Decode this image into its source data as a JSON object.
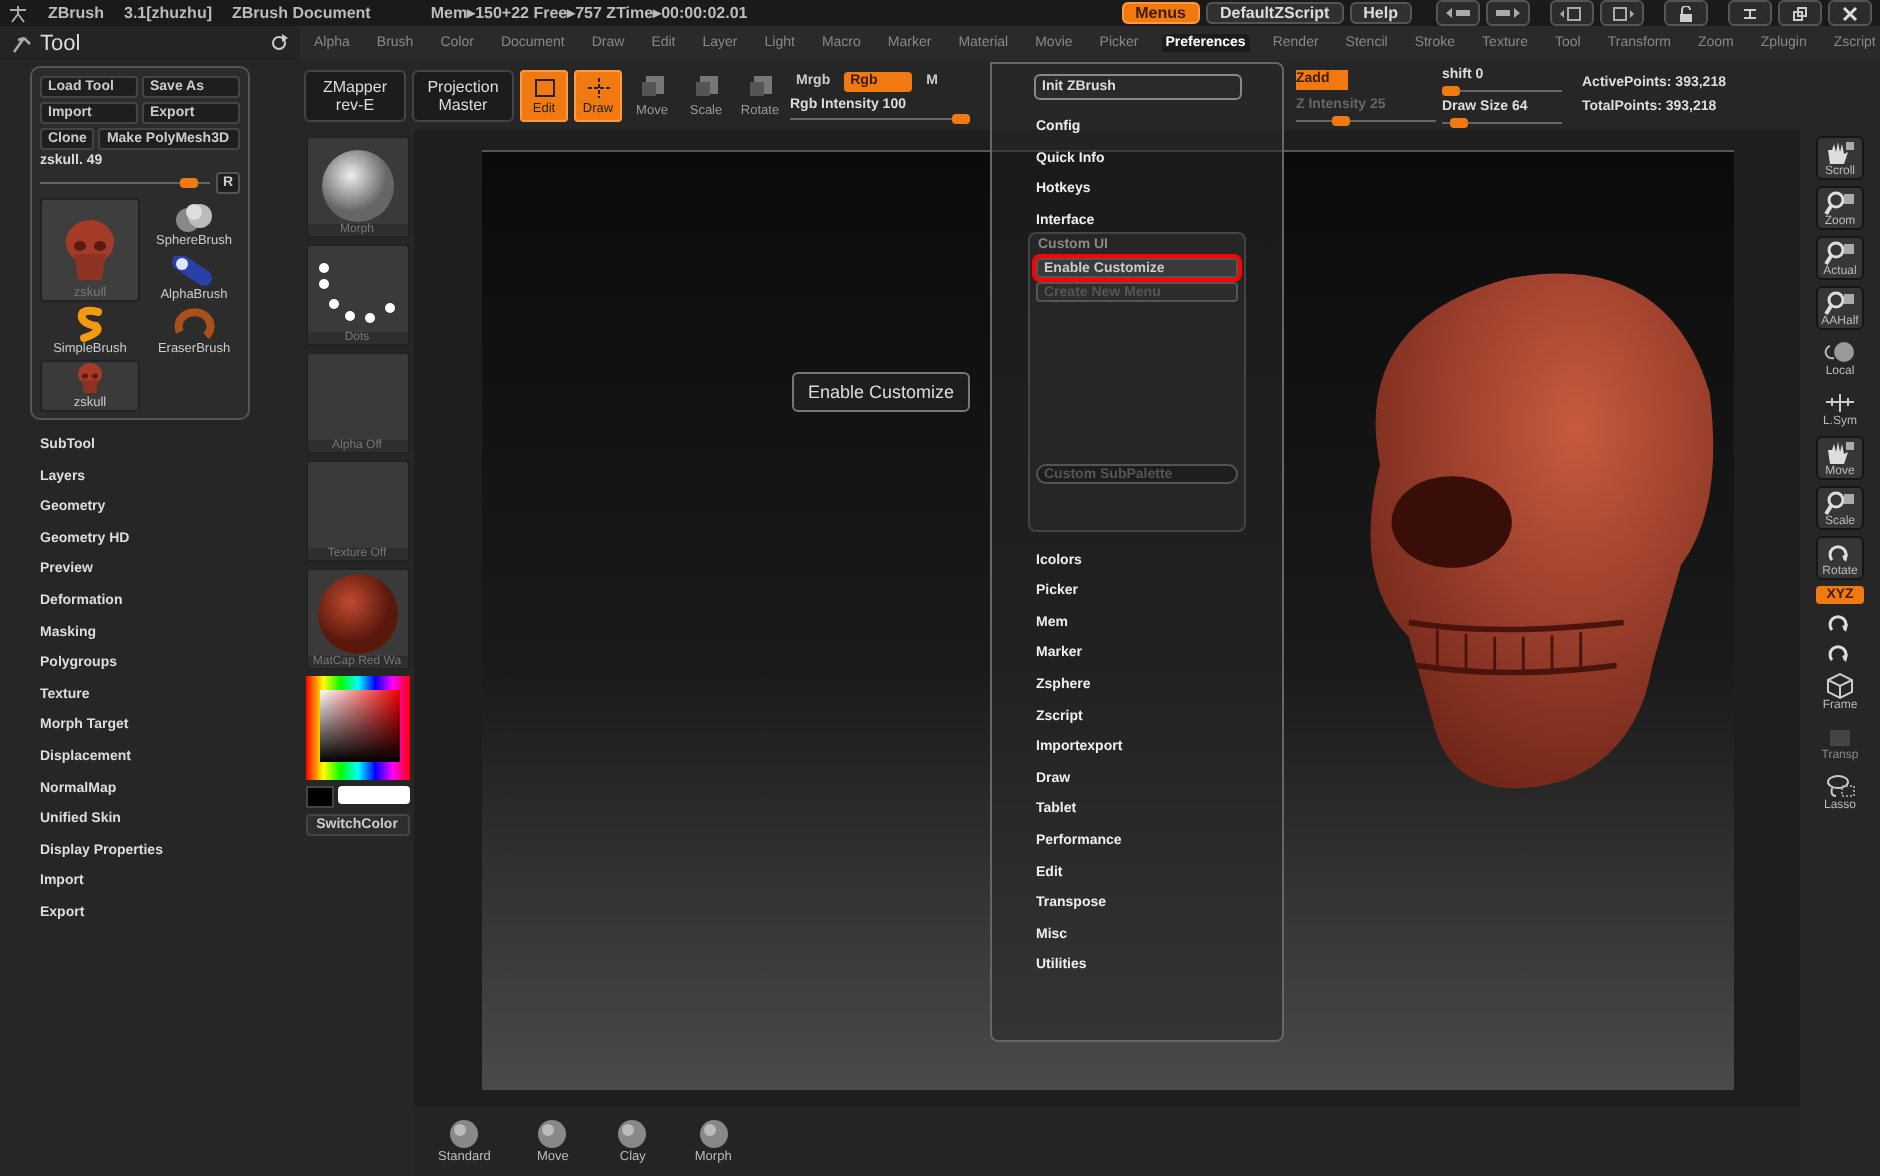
{
  "title_bar": {
    "app": "ZBrush",
    "version": "3.1[zhuzhu]",
    "document": "ZBrush Document",
    "stats": "Mem▸150+22 Free▸757 ZTime▸00:00:02.01",
    "buttons": [
      {
        "label": "Menus",
        "selected": true
      },
      {
        "label": "DefaultZScript",
        "selected": false
      },
      {
        "label": "Help",
        "selected": false
      }
    ]
  },
  "tool_palette": {
    "title": "Tool",
    "buttons": [
      "Load Tool",
      "Save As",
      "Import",
      "Export"
    ],
    "row_buttons": [
      "Clone",
      "Make PolyMesh3D"
    ],
    "slider": {
      "label": "zskull. 49",
      "level": 0.93
    },
    "reset": "R",
    "tools": [
      {
        "label": "zskull",
        "kind": "skull",
        "selected": true
      },
      {
        "label": "SimpleBrush",
        "kind": "simple",
        "selected": false
      },
      {
        "label": "zskull",
        "kind": "skull",
        "selected": false
      },
      {
        "label": "SphereBrush",
        "kind": "sphere",
        "selected": false
      },
      {
        "label": "AlphaBrush",
        "kind": "alpha",
        "selected": false
      },
      {
        "label": "EraserBrush",
        "kind": "eraser",
        "selected": false
      }
    ],
    "sections": [
      "SubTool",
      "Layers",
      "Geometry",
      "Geometry HD",
      "Preview",
      "Deformation",
      "Masking",
      "Polygroups",
      "Texture",
      "Morph Target",
      "Displacement",
      "NormalMap",
      "Unified Skin",
      "Display Properties",
      "Import",
      "Export"
    ]
  },
  "menu_bar": [
    {
      "label": "Alpha",
      "selected": false
    },
    {
      "label": "Brush",
      "selected": false
    },
    {
      "label": "Color",
      "selected": false
    },
    {
      "label": "Document",
      "selected": false
    },
    {
      "label": "Draw",
      "selected": false
    },
    {
      "label": "Edit",
      "selected": false
    },
    {
      "label": "Layer",
      "selected": false
    },
    {
      "label": "Light",
      "selected": false
    },
    {
      "label": "Macro",
      "selected": false
    },
    {
      "label": "Marker",
      "selected": false
    },
    {
      "label": "Material",
      "selected": false
    },
    {
      "label": "Movie",
      "selected": false
    },
    {
      "label": "Picker",
      "selected": false
    },
    {
      "label": "Preferences",
      "selected": true
    },
    {
      "label": "Render",
      "selected": false
    },
    {
      "label": "Stencil",
      "selected": false
    },
    {
      "label": "Stroke",
      "selected": false
    },
    {
      "label": "Texture",
      "selected": false
    },
    {
      "label": "Tool",
      "selected": false
    },
    {
      "label": "Transform",
      "selected": false
    },
    {
      "label": "Zoom",
      "selected": false
    },
    {
      "label": "Zplugin",
      "selected": false
    },
    {
      "label": "Zscript",
      "selected": false
    }
  ],
  "toolbar": {
    "plugins": [
      {
        "label": "ZMapper",
        "sublabel": "rev-E"
      },
      {
        "label": "Projection",
        "sublabel": "Master"
      }
    ],
    "modes": [
      {
        "label": "Edit",
        "kind": "edit",
        "selected": true
      },
      {
        "label": "Draw",
        "kind": "draw",
        "selected": true
      },
      {
        "label": "Move",
        "kind": "move",
        "selected": false
      },
      {
        "label": "Scale",
        "kind": "scale",
        "selected": false
      },
      {
        "label": "Rotate",
        "kind": "rotate",
        "selected": false
      }
    ],
    "color_modes": [
      {
        "label": "Mrgb",
        "selected": false
      },
      {
        "label": "Rgb",
        "selected": true
      },
      {
        "label": "M",
        "selected": false
      }
    ],
    "rgb_intensity": {
      "label": "Rgb Intensity",
      "value": "100",
      "level": 1.0
    },
    "zadd": {
      "label": "Zadd",
      "selected": true
    },
    "z_intensity": {
      "text": "Z Intensity 25",
      "level": 0.25
    },
    "focal_shift": {
      "label": "shift",
      "value": "0",
      "level": 0.0
    },
    "draw_size": {
      "label": "Draw Size",
      "value": "64",
      "level": 0.06
    },
    "active_points": "ActivePoints: 393,218",
    "total_points": "TotalPoints: 393,218"
  },
  "shelf": {
    "material": "Morph",
    "stroke": "Dots",
    "alpha": "Alpha Off",
    "texture": "Texture Off",
    "matcap": "MatCap Red Wa",
    "switch_color": "SwitchColor"
  },
  "preferences_menu": {
    "items": [
      {
        "kind": "button",
        "label": "Init ZBrush"
      },
      {
        "kind": "section",
        "label": "Config"
      },
      {
        "kind": "section",
        "label": "Quick Info"
      },
      {
        "kind": "section",
        "label": "Hotkeys"
      },
      {
        "kind": "section",
        "label": "Interface"
      },
      {
        "kind": "group",
        "label": "Custom UI",
        "expanded": true,
        "children": [
          {
            "label": "Enable Customize",
            "highlighted": true,
            "disabled": false
          },
          {
            "label": "Create New Menu",
            "highlighted": false,
            "disabled": true
          },
          {
            "label": "Custom SubPalette",
            "highlighted": false,
            "disabled": true
          }
        ]
      },
      {
        "kind": "section",
        "label": "Icolors"
      },
      {
        "kind": "section",
        "label": "Picker"
      },
      {
        "kind": "section",
        "label": "Mem"
      },
      {
        "kind": "section",
        "label": "Marker"
      },
      {
        "kind": "section",
        "label": "Zsphere"
      },
      {
        "kind": "section",
        "label": "Zscript"
      },
      {
        "kind": "section",
        "label": "Importexport"
      },
      {
        "kind": "section",
        "label": "Draw"
      },
      {
        "kind": "section",
        "label": "Tablet"
      },
      {
        "kind": "section",
        "label": "Performance"
      },
      {
        "kind": "section",
        "label": "Edit"
      },
      {
        "kind": "section",
        "label": "Transpose"
      },
      {
        "kind": "section",
        "label": "Misc"
      },
      {
        "kind": "section",
        "label": "Utilities"
      }
    ]
  },
  "tooltip": "Enable Customize",
  "right_toolbar": [
    {
      "kind": "tile",
      "label": "Scroll"
    },
    {
      "kind": "tile",
      "label": "Zoom"
    },
    {
      "kind": "tile",
      "label": "Actual"
    },
    {
      "kind": "tile",
      "label": "AAHalf"
    },
    {
      "kind": "plain",
      "label": "Local"
    },
    {
      "kind": "plain",
      "label": "L.Sym"
    },
    {
      "kind": "tile",
      "label": "Move"
    },
    {
      "kind": "tile",
      "label": "Scale"
    },
    {
      "kind": "tile",
      "label": "Rotate"
    },
    {
      "kind": "toggle",
      "label": "XYZ",
      "selected": true
    },
    {
      "kind": "small"
    },
    {
      "kind": "small"
    },
    {
      "kind": "plain",
      "label": "Frame"
    },
    {
      "kind": "disabled",
      "label": "Transp"
    },
    {
      "kind": "plain",
      "label": "Lasso"
    }
  ],
  "brush_shelf": [
    "Standard",
    "Move",
    "Clay",
    "Morph"
  ]
}
